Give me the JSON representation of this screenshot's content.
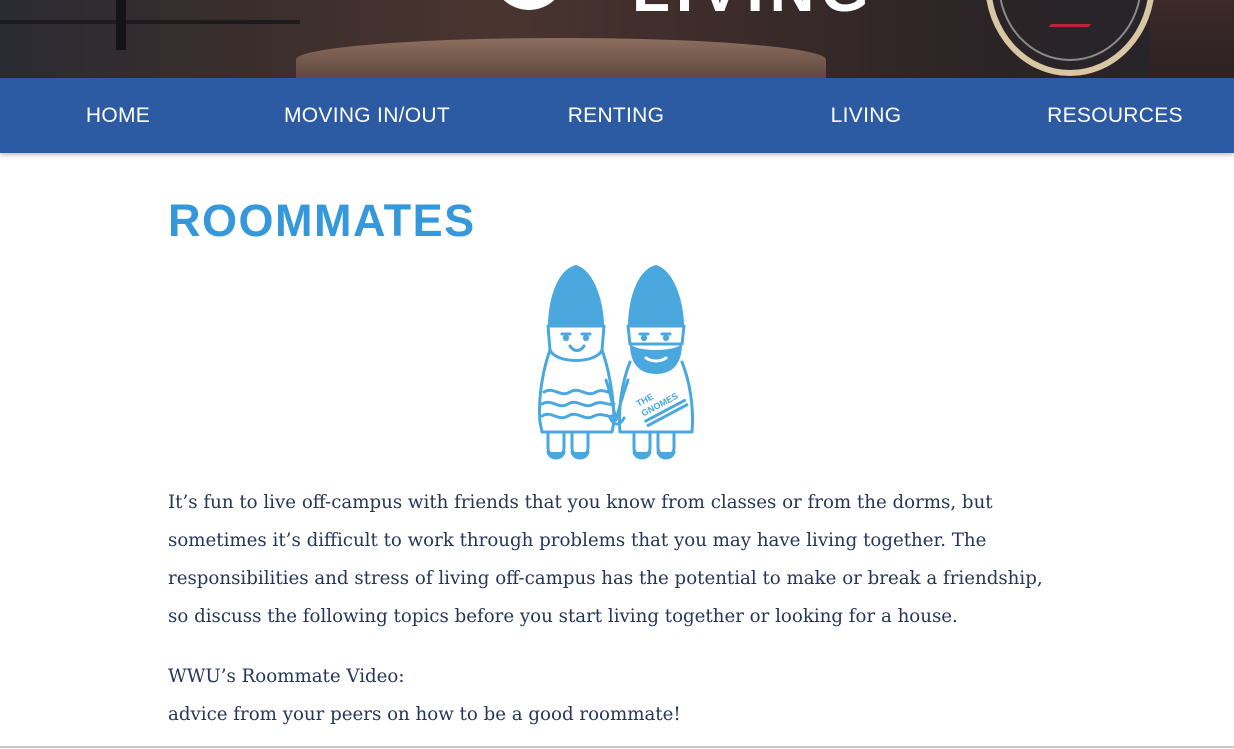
{
  "nav": {
    "items": [
      {
        "label": "HOME"
      },
      {
        "label": "MOVING IN/OUT"
      },
      {
        "label": "RENTING"
      },
      {
        "label": "LIVING"
      },
      {
        "label": "RESOURCES"
      }
    ]
  },
  "hero": {
    "logo_text": "LIVING",
    "image": "bicycle-and-table-photo"
  },
  "page": {
    "title": "ROOMMATES",
    "illustration": "gnomes-holding-hands",
    "illustration_text": [
      "THE",
      "GNOMES"
    ],
    "paragraph": "It’s fun to live off-campus with friends that you know from classes or from the dorms, but sometimes it’s difficult to work through problems that you may have living together. The responsibilities and stress of living off-campus has the potential to make or break a friendship, so discuss the following topics before you start living together or looking for a house.",
    "video_label": "WWU’s Roommate Video:",
    "video_desc": "advice from your peers on how to be a good roommate!"
  },
  "colors": {
    "nav_bg": "#2c5aa3",
    "title": "#3498db",
    "body_text": "#253659",
    "illustration": "#4aa8de"
  }
}
